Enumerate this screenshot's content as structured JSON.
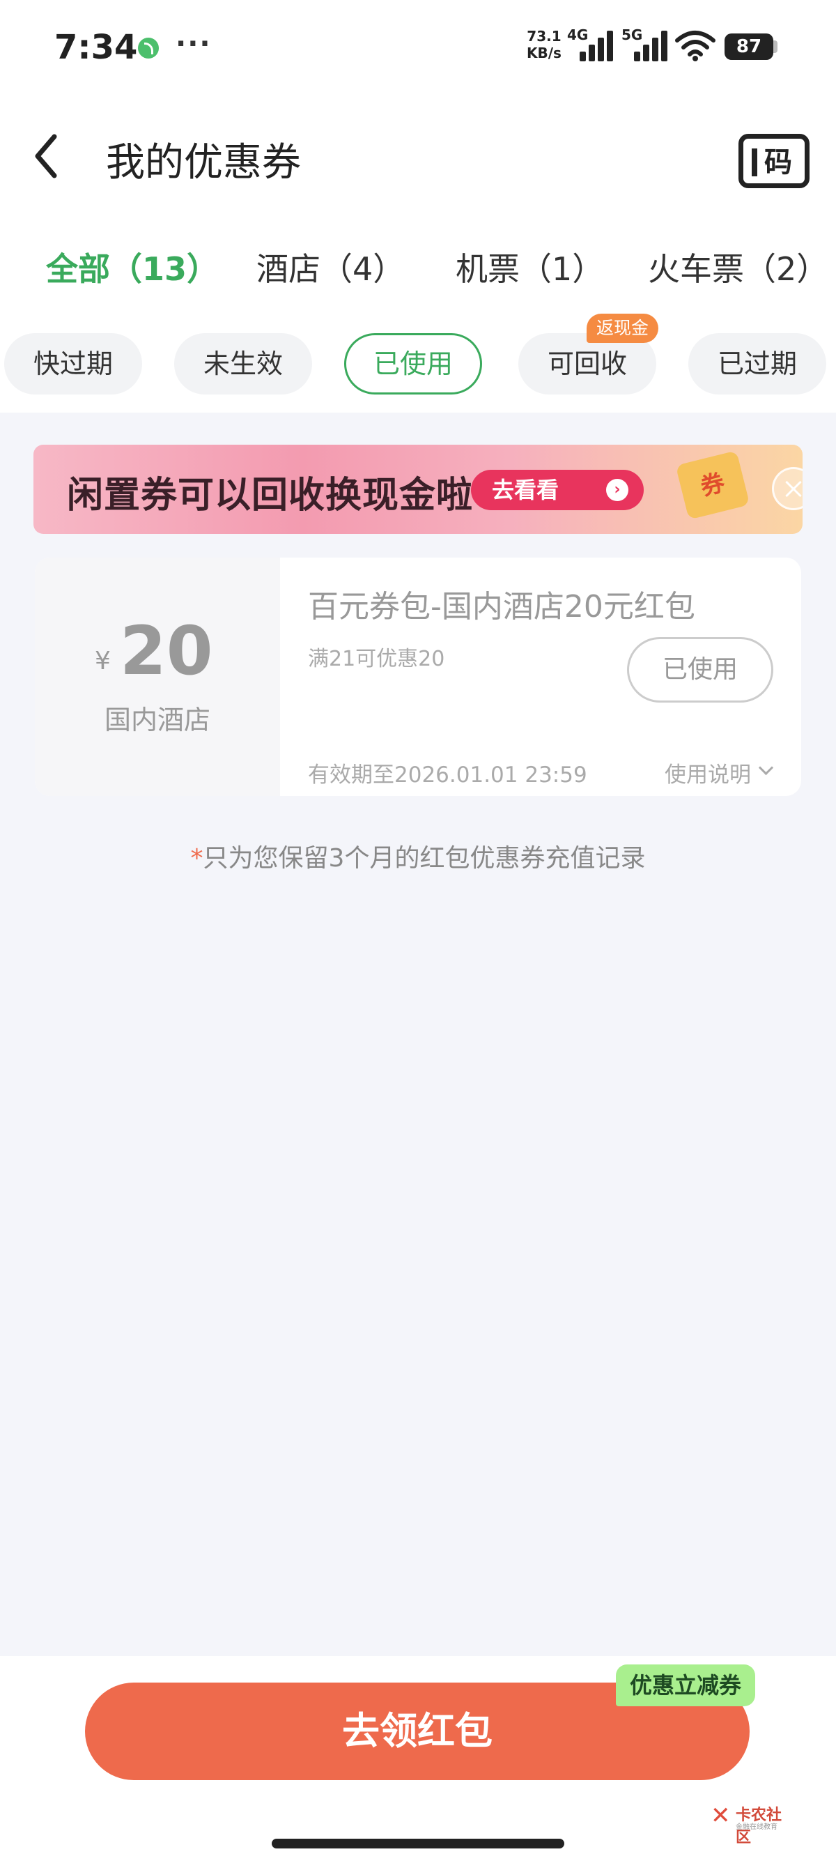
{
  "status": {
    "time": "7:34",
    "more": "···",
    "speed_value": "73.1",
    "speed_unit": "KB/s",
    "net1": "4G",
    "net2": "5G",
    "battery": "87"
  },
  "header": {
    "title": "我的优惠券",
    "scan_label": "码"
  },
  "tabs": [
    {
      "label": "全部（13）",
      "active": true
    },
    {
      "label": "酒店（4）"
    },
    {
      "label": "机票（1）"
    },
    {
      "label": "火车票（2）"
    }
  ],
  "filters": [
    {
      "label": "快过期"
    },
    {
      "label": "未生效"
    },
    {
      "label": "已使用",
      "selected": true
    },
    {
      "label": "可回收",
      "badge": "返现金"
    },
    {
      "label": "已过期"
    }
  ],
  "banner": {
    "text": "闲置券可以回收换现金啦",
    "button": "去看看",
    "deco": "券"
  },
  "coupon": {
    "currency": "¥",
    "amount": "20",
    "scope": "国内酒店",
    "title": "百元券包-国内酒店20元红包",
    "condition": "满21可优惠20",
    "status": "已使用",
    "validity": "有效期至2026.01.01 23:59",
    "help": "使用说明"
  },
  "note": {
    "star": "*",
    "text": "只为您保留3个月的红包优惠券充值记录"
  },
  "bottom": {
    "cta": "去领红包",
    "tag": "优惠立减券",
    "watermark": "卡农社区",
    "watermark_sub": "金融在线教育"
  },
  "colors": {
    "accent_green": "#3aaa5c",
    "cta_orange": "#ee6a4c",
    "badge_orange": "#f58b42"
  }
}
